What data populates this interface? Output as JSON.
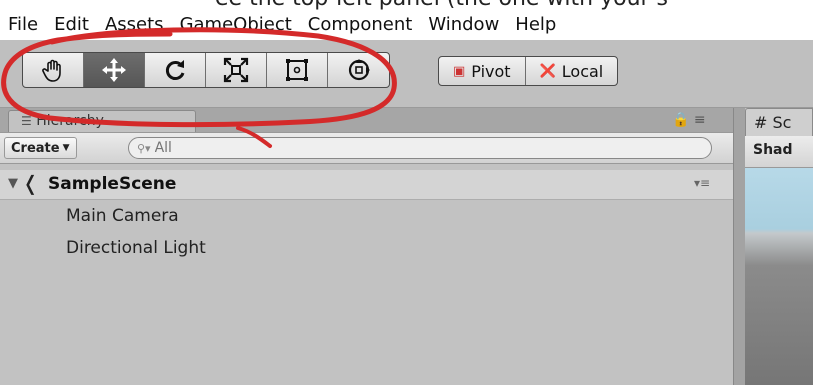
{
  "menu": {
    "cut_off_text": "ee the top-left panel (the one with your s",
    "items": [
      "File",
      "Edit",
      "Assets",
      "GameObject",
      "Component",
      "Window",
      "Help"
    ]
  },
  "toolbar": {
    "tools": [
      {
        "name": "hand-tool",
        "icon": "hand-icon",
        "active": false
      },
      {
        "name": "move-tool",
        "icon": "move-arrows-icon",
        "active": true
      },
      {
        "name": "rotate-tool",
        "icon": "rotate-icon",
        "active": false
      },
      {
        "name": "scale-tool",
        "icon": "scale-icon",
        "active": false
      },
      {
        "name": "rect-tool",
        "icon": "rect-transform-icon",
        "active": false
      },
      {
        "name": "transform-tool",
        "icon": "transform-icon",
        "active": false
      }
    ],
    "pivot_label": "Pivot",
    "local_label": "Local"
  },
  "hierarchy": {
    "tab_label": "Hierarchy",
    "create_label": "Create",
    "search_placeholder": "All",
    "scene_name": "SampleScene",
    "items": [
      "Main Camera",
      "Directional Light"
    ]
  },
  "scene_panel": {
    "tab_label": "# Sc",
    "shading_label": "Shad"
  },
  "colors": {
    "annotation": "#d42a2a",
    "active_tool": "#5e5e5e",
    "panel_bg": "#c2c2c2"
  }
}
